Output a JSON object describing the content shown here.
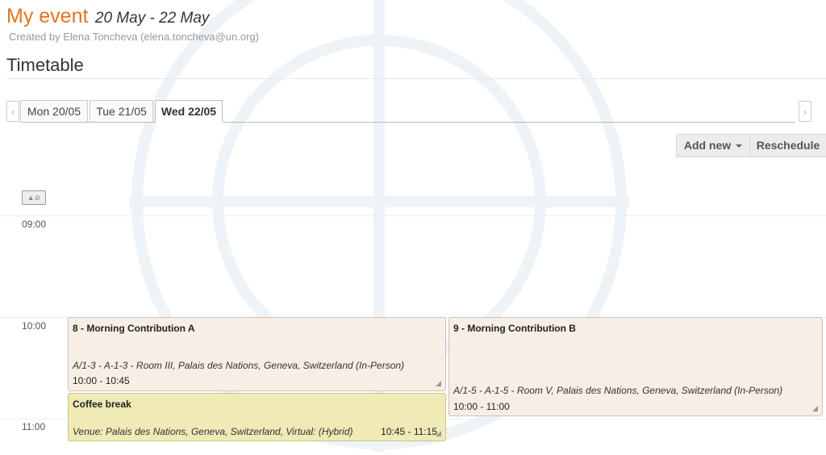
{
  "event": {
    "name": "My event",
    "dates": "20 May - 22 May",
    "created_by": "Created by Elena Toncheva (elena.toncheva@un.org)"
  },
  "section_title": "Timetable",
  "nav": {
    "prev_icon": "chevron-left-icon",
    "next_icon": "chevron-right-icon",
    "prev_glyph": "‹",
    "next_glyph": "›"
  },
  "tabs": [
    {
      "label": "Mon 20/05",
      "active": false
    },
    {
      "label": "Tue 21/05",
      "active": false
    },
    {
      "label": "Wed 22/05",
      "active": true
    }
  ],
  "toolbar": {
    "add_new_label": "Add new",
    "reschedule_label": "Reschedule"
  },
  "toggle": {
    "icon": "layout-toggle-icon",
    "glyph": "▲⊘"
  },
  "hours": [
    "09:00",
    "10:00",
    "11:00"
  ],
  "entries": [
    {
      "title": "8 - Morning Contribution A",
      "location": "A/1-3 - A-1-3 - Room III, Palais des Nations, Geneva, Switzerland (In-Person)",
      "time": "10:00 - 10:45"
    },
    {
      "title": "9 - Morning Contribution B",
      "location": "A/1-5 - A-1-5 - Room V, Palais des Nations, Geneva, Switzerland (In-Person)",
      "time": "10:00 - 11:00"
    },
    {
      "title": "Coffee break",
      "location": "Venue: Palais des Nations, Geneva, Switzerland, Virtual: (Hybrid)",
      "time": "10:45 - 11:15"
    }
  ],
  "colors": {
    "accent": "#e5731d",
    "contribution_bg": "#f7efe6",
    "break_bg": "#efeab6"
  }
}
